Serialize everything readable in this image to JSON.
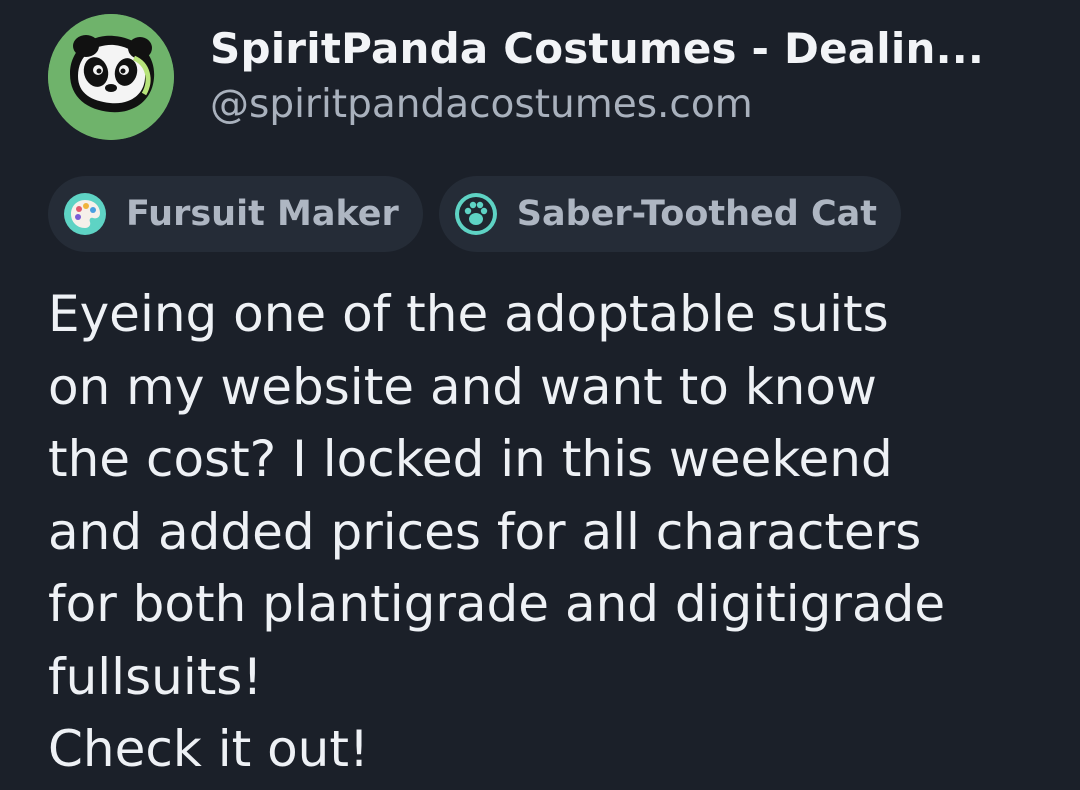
{
  "profile": {
    "display_name": "SpiritPanda Costumes - Dealin...",
    "handle": "@spiritpandacostumes.com"
  },
  "tags": [
    {
      "label": "Fursuit Maker",
      "icon": "palette-icon",
      "color": "#5ed3c4"
    },
    {
      "label": "Saber-Toothed Cat",
      "icon": "paw-icon",
      "color": "#5ed3c4"
    }
  ],
  "post": {
    "text": "Eyeing one of the adoptable suits\non my website and want to know\nthe cost? I locked in this weekend\nand added prices for all characters\nfor both plantigrade and digitigrade\nfullsuits!\nCheck it out!"
  },
  "colors": {
    "background": "#1b2029",
    "tag_background": "#252c37",
    "avatar_green": "#6fb36b"
  }
}
